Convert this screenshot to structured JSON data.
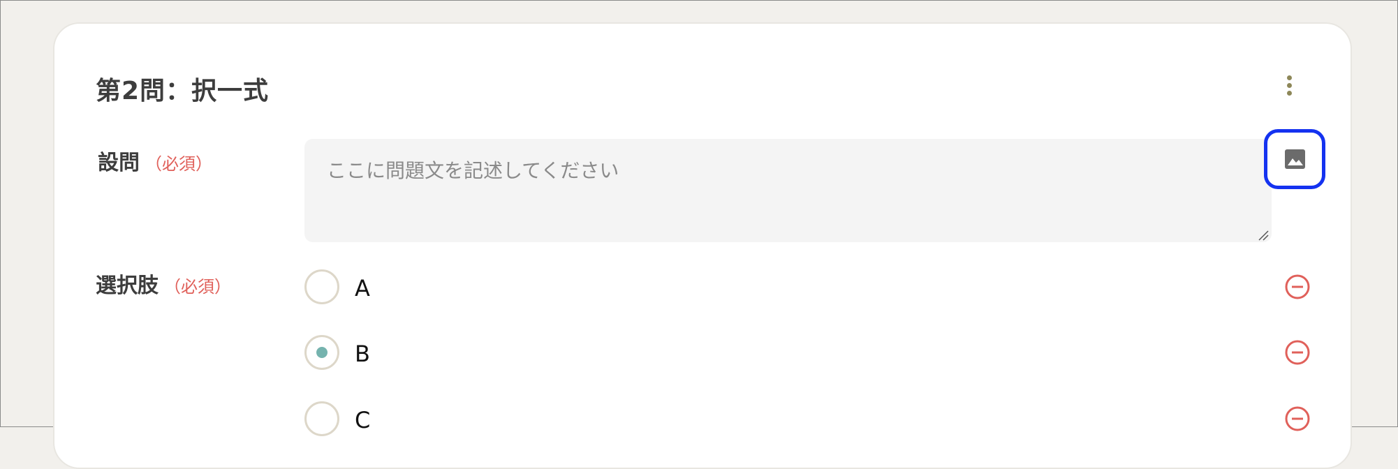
{
  "question": {
    "title": "第2問：択一式",
    "menu_icon": "kebab-menu-icon"
  },
  "prompt_field": {
    "label": "設問",
    "required": "（必須）",
    "placeholder": "ここに問題文を記述してください",
    "value": "",
    "image_button_icon": "image-icon"
  },
  "choices_field": {
    "label": "選択肢",
    "required": "（必須）",
    "options": [
      {
        "label": "A",
        "selected": false
      },
      {
        "label": "B",
        "selected": true
      },
      {
        "label": "C",
        "selected": false
      }
    ],
    "remove_icon": "minus-circle-icon"
  },
  "colors": {
    "accent_required": "#e0605a",
    "radio_selected": "#75b3ae",
    "image_button_border": "#1432f0",
    "menu_dots": "#8d8758"
  }
}
